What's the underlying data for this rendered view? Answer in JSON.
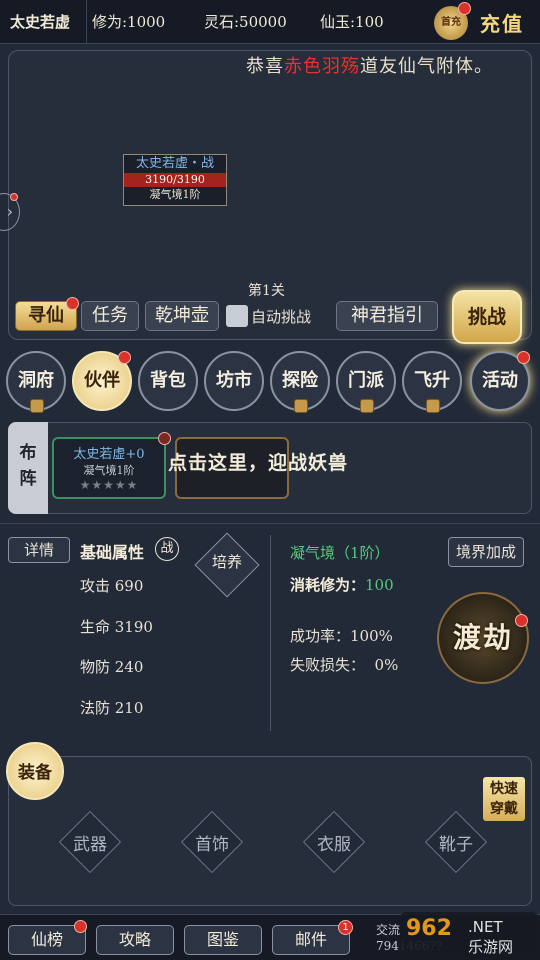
{
  "topbar": {
    "player_name": "太史若虚",
    "cultivation": "修为:1000",
    "spirit_stone": "灵石:50000",
    "immortal_jade": "仙玉:100",
    "gift_label": "首充",
    "recharge_label": "充值"
  },
  "notice": {
    "prefix": "恭喜",
    "highlight": "赤色羽殇",
    "suffix": "道友仙气附体。"
  },
  "enemy": {
    "name": "太史若虚・战",
    "hp": "3190/3190",
    "realm": "凝气境1阶"
  },
  "stage": {
    "level_label": "第1关"
  },
  "actions": {
    "seek_immortal": "寻仙",
    "task": "任务",
    "qiankun_pot": "乾坤壶",
    "auto_challenge": "自动挑战",
    "guide": "神君指引",
    "challenge": "挑战"
  },
  "nav": [
    {
      "label": "洞府"
    },
    {
      "label": "伙伴"
    },
    {
      "label": "背包"
    },
    {
      "label": "坊市"
    },
    {
      "label": "探险"
    },
    {
      "label": "门派"
    },
    {
      "label": "飞升"
    },
    {
      "label": "活动"
    }
  ],
  "formation": {
    "tab_label": "布阵",
    "partner_name": "太史若虚+0",
    "partner_realm": "凝气境1阶",
    "partner_stars": "★★★★★",
    "hint": "点击这里，迎战妖兽"
  },
  "attributes": {
    "detail_label": "详情",
    "title": "基础属性",
    "battle_tag": "战",
    "cultivate_label": "培养",
    "attack": "攻击 690",
    "hp": "生命 3190",
    "phys_def": "物防 240",
    "magic_def": "法防 210"
  },
  "breakthrough": {
    "realm": "凝气境（1阶）",
    "cost_label": "消耗修为：",
    "cost_value": "100",
    "bonus_label": "境界加成",
    "success_rate": "成功率：100%",
    "fail_loss": "失败损失：  0%",
    "tribulation_label": "渡劫"
  },
  "equipment": {
    "tab_label": "装备",
    "quick_equip": "快速穿戴",
    "slots": [
      {
        "label": "武器"
      },
      {
        "label": "首饰"
      },
      {
        "label": "衣服"
      },
      {
        "label": "靴子"
      }
    ]
  },
  "bottom": {
    "ranking": "仙榜",
    "guide": "攻略",
    "atlas": "图鉴",
    "mail": "邮件",
    "mail_badge": "1",
    "qq_label": "交流",
    "qq_number": "7941466??"
  },
  "watermark": {
    "brand": "962",
    "net": ".NET",
    "cn": "乐游网"
  },
  "colors": {
    "accent_gold": "#e6c679",
    "name_blue": "#7fb8e8",
    "highlight_red": "#f0302a",
    "realm_green": "#58c97c"
  }
}
